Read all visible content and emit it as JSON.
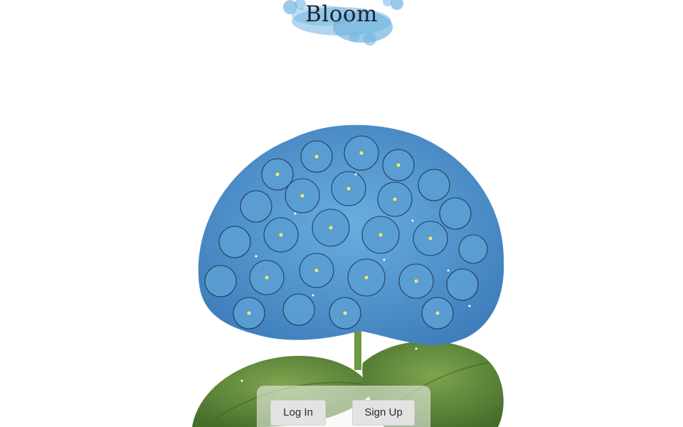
{
  "brand": {
    "title": "Bloom",
    "logo_icon": "watercolor-splash-icon",
    "logo_color": "#5aa7dc"
  },
  "hero": {
    "illustration": "hydrangea-illustration-icon",
    "petal_color": "#4f93c9",
    "leaf_color": "#5f8a3a"
  },
  "auth": {
    "login_label": "Log In",
    "signup_label": "Sign Up"
  }
}
